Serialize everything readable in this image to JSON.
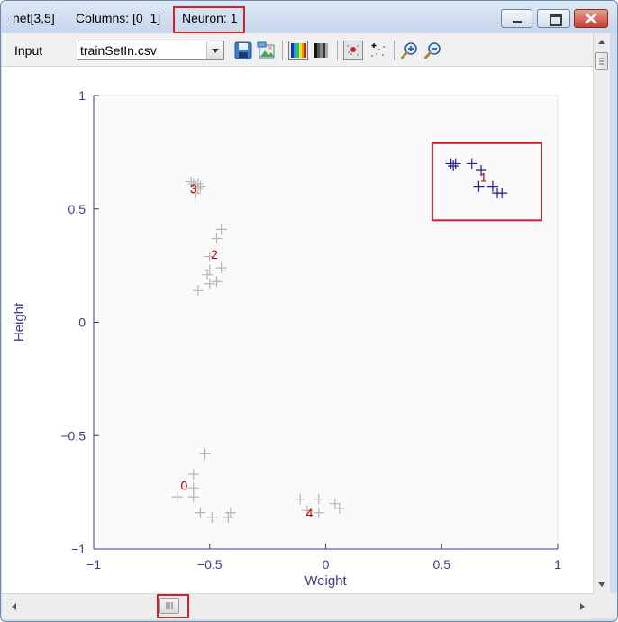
{
  "title": {
    "net": "net[3,5]",
    "columns": "Columns: [0  1]",
    "neuron": "Neuron: 1"
  },
  "window_controls": {
    "minimize": "minimize-icon",
    "maximize": "maximize-icon",
    "close": "close-icon"
  },
  "toolbar": {
    "input_label": "Input",
    "file_selected": "trainSetIn.csv",
    "tools": [
      "save-icon",
      "load-image-icon",
      "color-spectrum-icon",
      "grayscale-spectrum-icon",
      "show-neurons-icon",
      "scatter-points-icon",
      "zoom-in-icon",
      "zoom-out-icon"
    ]
  },
  "colors": {
    "highlight_red": "#d51f2a",
    "axis_blue": "#3b3b9a",
    "selected_points": "#1c1ca0",
    "other_points": "#b5b5b5",
    "neuron_label": "#c00000"
  },
  "chart_data": {
    "type": "scatter",
    "title": "",
    "xlabel": "Weight",
    "ylabel": "Height",
    "xlim": [
      -1,
      1
    ],
    "ylim": [
      -1,
      1
    ],
    "xticks": [
      "−1",
      "−0.5",
      "0",
      "0.5",
      "1"
    ],
    "yticks": [
      "1",
      "0.5",
      "0",
      "−0.5",
      "−1"
    ],
    "xtick_values": [
      -1,
      -0.5,
      0,
      0.5,
      1
    ],
    "ytick_values": [
      1,
      0.5,
      0,
      -0.5,
      -1
    ],
    "grid": false,
    "highlight_label": "1",
    "series": [
      {
        "points": [
          [
            -0.57,
            0.61
          ],
          [
            -0.55,
            0.61
          ],
          [
            -0.56,
            0.6
          ],
          [
            -0.55,
            0.59
          ],
          [
            -0.56,
            0.57
          ],
          [
            -0.58,
            0.62
          ],
          [
            -0.54,
            0.6
          ],
          [
            -0.5,
            0.29
          ],
          [
            -0.5,
            0.23
          ],
          [
            -0.51,
            0.21
          ],
          [
            -0.5,
            0.17
          ],
          [
            -0.47,
            0.18
          ],
          [
            -0.45,
            0.24
          ],
          [
            -0.45,
            0.41
          ],
          [
            -0.47,
            0.37
          ],
          [
            -0.55,
            0.14
          ],
          [
            -0.52,
            -0.58
          ],
          [
            -0.57,
            -0.67
          ],
          [
            -0.57,
            -0.73
          ],
          [
            -0.57,
            -0.77
          ],
          [
            -0.64,
            -0.77
          ],
          [
            -0.54,
            -0.84
          ],
          [
            -0.49,
            -0.86
          ],
          [
            -0.42,
            -0.86
          ],
          [
            -0.41,
            -0.84
          ],
          [
            -0.11,
            -0.78
          ],
          [
            -0.08,
            -0.83
          ],
          [
            -0.03,
            -0.78
          ],
          [
            -0.03,
            -0.84
          ],
          [
            0.04,
            -0.8
          ],
          [
            0.06,
            -0.82
          ]
        ]
      },
      {
        "points": [
          [
            0.54,
            0.7
          ],
          [
            0.55,
            0.69
          ],
          [
            0.56,
            0.7
          ],
          [
            0.63,
            0.7
          ],
          [
            0.67,
            0.67
          ],
          [
            0.66,
            0.6
          ],
          [
            0.72,
            0.6
          ],
          [
            0.74,
            0.57
          ],
          [
            0.76,
            0.57
          ]
        ]
      }
    ],
    "neurons": [
      {
        "label": "0",
        "x": -0.61,
        "y": -0.72
      },
      {
        "label": "1",
        "x": 0.68,
        "y": 0.64
      },
      {
        "label": "2",
        "x": -0.48,
        "y": 0.3
      },
      {
        "label": "3",
        "x": -0.57,
        "y": 0.59
      },
      {
        "label": "4",
        "x": -0.07,
        "y": -0.84
      }
    ]
  }
}
